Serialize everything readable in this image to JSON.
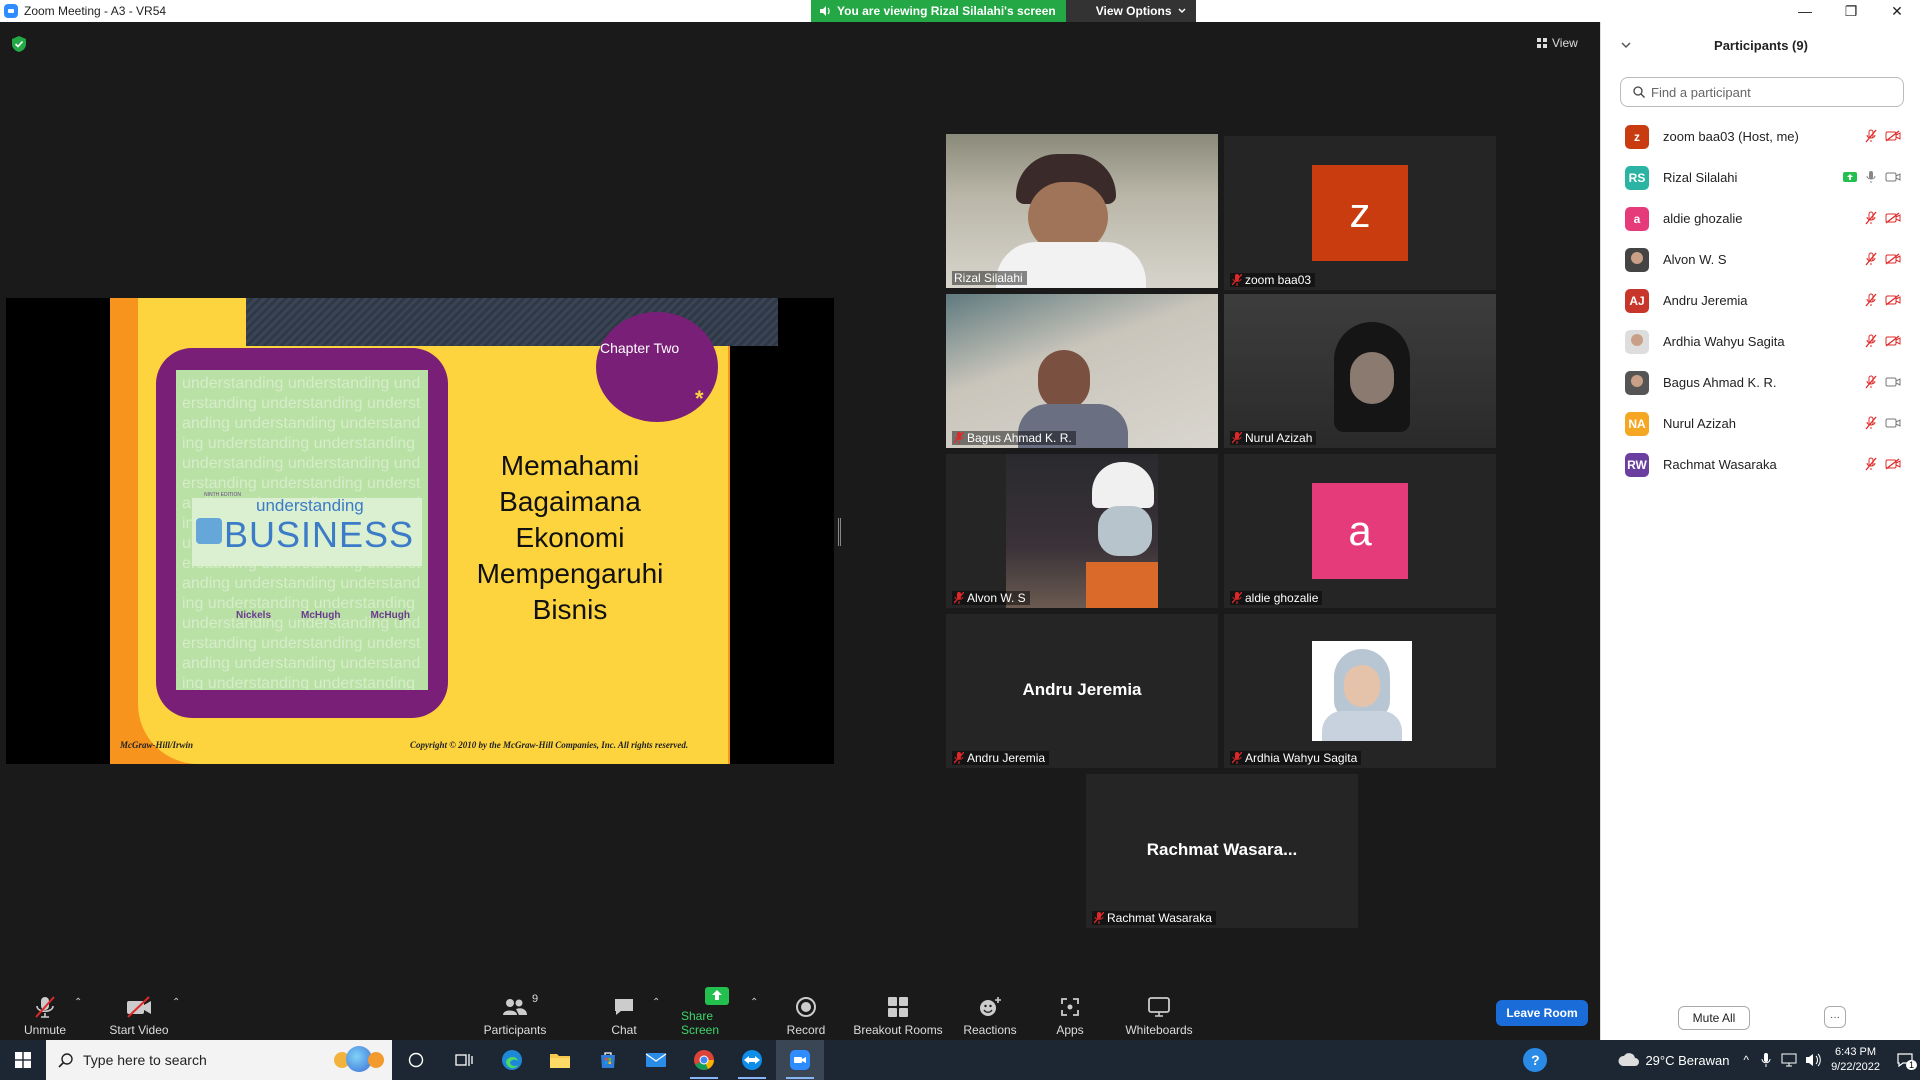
{
  "window": {
    "title": "Zoom Meeting - A3 - VR54",
    "minimize": "—",
    "restore": "❐",
    "close": "✕"
  },
  "banner": {
    "viewing_text": "You are viewing Rizal Silalahi's screen",
    "view_options": "View Options"
  },
  "meeting": {
    "view_label": "View"
  },
  "slide": {
    "chapter": "Chapter Two",
    "asterisk": "*",
    "book_edition": "NINTH EDITION",
    "book_subtitle": "understanding",
    "book_title": "BUSINESS",
    "authors": [
      "Nickels",
      "McHugh",
      "McHugh"
    ],
    "heading_lines": [
      "Memahami",
      "Bagaimana",
      "Ekonomi",
      "Mempengaruhi",
      "Bisnis"
    ],
    "footer_left": "McGraw-Hill/Irwin",
    "footer_right": "Copyright © 2010 by the McGraw-Hill Companies, Inc. All rights reserved."
  },
  "gallery": [
    {
      "name": "Rizal Silalahi",
      "type": "video",
      "active": true,
      "mic_muted": false
    },
    {
      "name": "zoom baa03",
      "type": "avatar",
      "initial": "z",
      "color": "#c83c10",
      "mic_muted": true
    },
    {
      "name": "Bagus Ahmad K. R.",
      "type": "video",
      "mic_muted": true
    },
    {
      "name": "Nurul Azizah",
      "type": "video",
      "mic_muted": true
    },
    {
      "name": "Alvon W. S",
      "type": "video",
      "mic_muted": true
    },
    {
      "name": "aldie ghozalie",
      "type": "avatar",
      "initial": "a",
      "color": "#e63b7a",
      "mic_muted": true
    },
    {
      "name": "Andru Jeremia",
      "type": "name",
      "display": "Andru Jeremia",
      "mic_muted": true
    },
    {
      "name": "Ardhia Wahyu Sagita",
      "type": "photo",
      "mic_muted": true
    },
    {
      "name": "Rachmat Wasaraka",
      "type": "name",
      "display": "Rachmat Wasara...",
      "mic_muted": true
    }
  ],
  "participants_panel": {
    "title": "Participants (9)",
    "search_placeholder": "Find a participant",
    "participants": [
      {
        "name": "zoom baa03 (Host, me)",
        "initials": "z",
        "color": "#c83c10",
        "muted": true,
        "video_off": true
      },
      {
        "name": "Rizal Silalahi",
        "initials": "RS",
        "color": "#2bb3a3",
        "muted": false,
        "video_off": false,
        "sharing": true
      },
      {
        "name": "aldie ghozalie",
        "initials": "a",
        "color": "#e63b7a",
        "muted": true,
        "video_off": true
      },
      {
        "name": "Alvon W. S",
        "initials": "",
        "color": "#444444",
        "muted": true,
        "video_off": true
      },
      {
        "name": "Andru Jeremia",
        "initials": "AJ",
        "color": "#c8352a",
        "muted": true,
        "video_off": true
      },
      {
        "name": "Ardhia Wahyu Sagita",
        "initials": "",
        "color": "#dddddd",
        "muted": true,
        "video_off": true
      },
      {
        "name": "Bagus Ahmad K. R.",
        "initials": "",
        "color": "#555555",
        "muted": true,
        "video_off": false
      },
      {
        "name": "Nurul Azizah",
        "initials": "NA",
        "color": "#f5a623",
        "muted": true,
        "video_off": false
      },
      {
        "name": "Rachmat Wasaraka",
        "initials": "RW",
        "color": "#6b3fa0",
        "muted": true,
        "video_off": true
      }
    ],
    "mute_all": "Mute All",
    "more": "···"
  },
  "toolbar": {
    "unmute": "Unmute",
    "start_video": "Start Video",
    "participants": "Participants",
    "participants_count": "9",
    "chat": "Chat",
    "share_screen": "Share Screen",
    "record": "Record",
    "breakout_rooms": "Breakout Rooms",
    "reactions": "Reactions",
    "apps": "Apps",
    "whiteboards": "Whiteboards",
    "leave_room": "Leave Room"
  },
  "taskbar": {
    "search_placeholder": "Type here to search",
    "weather": "29°C  Berawan",
    "time": "6:43 PM",
    "date": "9/22/2022",
    "notification_count": "1"
  },
  "colors": {
    "zoom_blue": "#2d8cff",
    "share_green": "#23a845",
    "active_speaker": "#c5e63c",
    "muted_red": "#e02828",
    "leave_blue": "#1a6dd9"
  }
}
